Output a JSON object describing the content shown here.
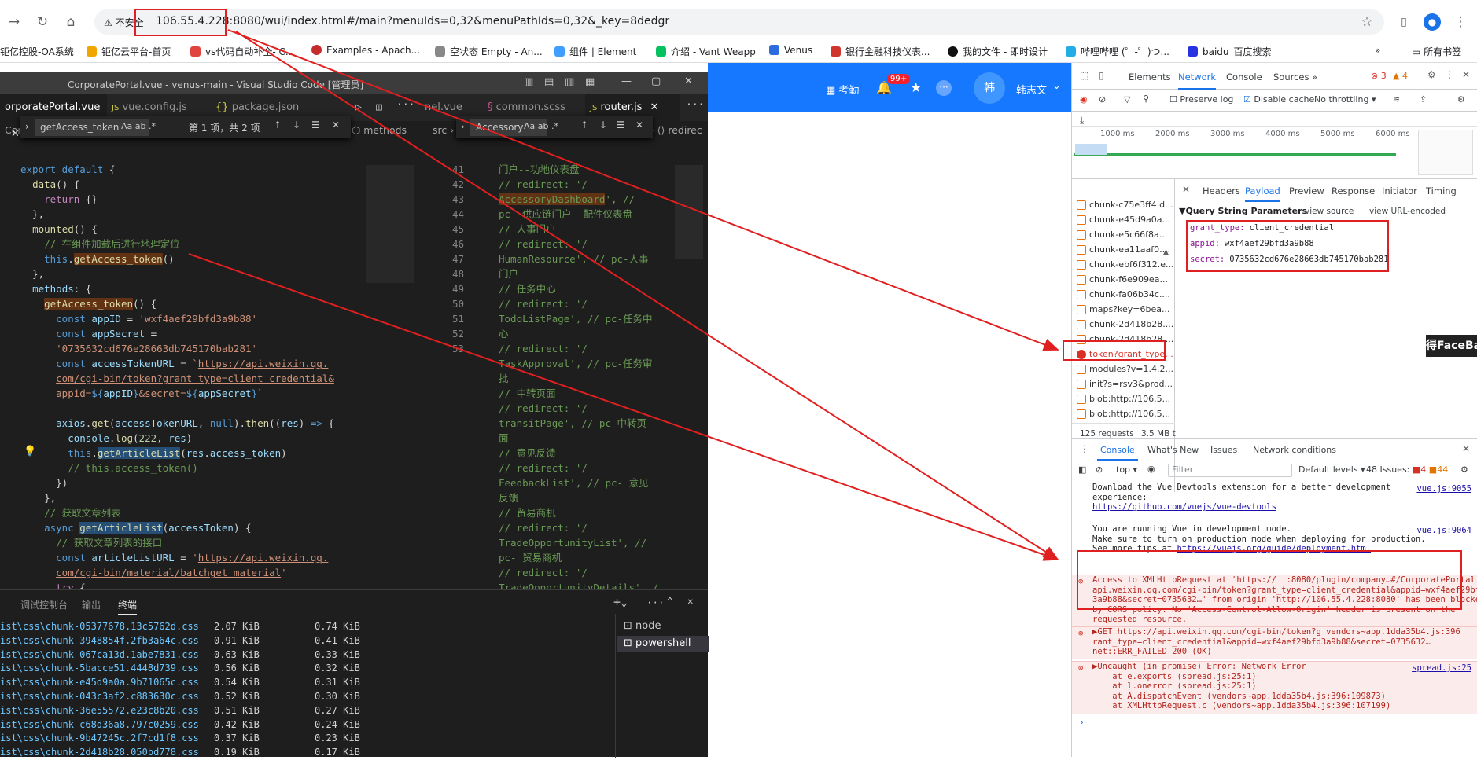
{
  "browser": {
    "security_label": "不安全",
    "url": "106.55.4.228:8080/wui/index.html#/main?menuIds=0,32&menuPathIds=0,32&_key=8dedgr",
    "bookmarks": [
      "钜亿控股-OA系统",
      "钜亿云平台-首页",
      "vs代码自动补全- C...",
      "Examples - Apach...",
      "空状态 Empty - An...",
      "组件 | Element",
      "介绍 - Vant Weapp",
      "Venus",
      "银行金融科技仪表...",
      "我的文件 - 即时设计",
      "哔哩哔哩 (゜-゜)つ...",
      "baidu_百度搜索"
    ],
    "all_bookmarks": "所有书签"
  },
  "app_header": {
    "attendance": "考勤",
    "badge": "99+",
    "user_initial": "韩",
    "user_name": "韩志文"
  },
  "vscode": {
    "title": "CorporatePortal.vue - venus-main - Visual Studio Code [管理员]",
    "tabs": [
      {
        "label": "orporatePortal.vue",
        "icon": "V",
        "icon_color": "#42b883",
        "active": true,
        "close": "✕"
      },
      {
        "label": "vue.config.js",
        "icon": "JS",
        "icon_color": "#cbcb41",
        "active": false
      },
      {
        "label": "package.json",
        "icon": "{}",
        "icon_color": "#cbcb41",
        "active": false
      }
    ],
    "right_tabs": [
      {
        "label": "nel.vue",
        "icon": "",
        "icon_color": "#42b883"
      },
      {
        "label": "common.scss",
        "icon": "§",
        "icon_color": "#c6538c"
      },
      {
        "label": "router.js",
        "icon": "JS",
        "icon_color": "#cbcb41",
        "close": "✕"
      }
    ],
    "left_breadcrumb": "CorporatePortal.vue › {} \"CorporatePortal.vue\" › ⟨⟩ script › ⬡ default › ⬡ methods",
    "right_breadcrumb": "src › router › JS router.js › ⟨⟩ constantRoutes › ⟨⟩ redirec",
    "find_left": {
      "query": "getAccess_token",
      "opts": "Aa  ab  .*",
      "result": "第 1 项，共 2 项"
    },
    "find_right": {
      "query": "Accessory",
      "opts": "Aa  ab  .*"
    },
    "right_line_numbers": [
      "",
      "41",
      "",
      "",
      "42",
      "43",
      "",
      "",
      "44",
      "45",
      "",
      "46",
      "",
      "47",
      "48",
      "",
      "49",
      "50",
      "",
      "51",
      "52",
      "",
      "53"
    ],
    "panel_tabs": [
      "调试控制台",
      "输出",
      "终端"
    ],
    "terminal_rows": [
      [
        "ist\\css\\chunk-05377678.13c5762d.css",
        "2.07 KiB",
        "0.74 KiB"
      ],
      [
        "ist\\css\\chunk-3948854f.2fb3a64c.css",
        "0.91 KiB",
        "0.41 KiB"
      ],
      [
        "ist\\css\\chunk-067ca13d.1abe7831.css",
        "0.63 KiB",
        "0.33 KiB"
      ],
      [
        "ist\\css\\chunk-5bacce51.4448d739.css",
        "0.56 KiB",
        "0.32 KiB"
      ],
      [
        "ist\\css\\chunk-e45d9a0a.9b71065c.css",
        "0.54 KiB",
        "0.31 KiB"
      ],
      [
        "ist\\css\\chunk-043c3af2.c883630c.css",
        "0.52 KiB",
        "0.30 KiB"
      ],
      [
        "ist\\css\\chunk-36e55572.e23c8b20.css",
        "0.51 KiB",
        "0.27 KiB"
      ],
      [
        "ist\\css\\chunk-c68d36a8.797c0259.css",
        "0.42 KiB",
        "0.24 KiB"
      ],
      [
        "ist\\css\\chunk-9b47245c.2f7cd1f8.css",
        "0.37 KiB",
        "0.23 KiB"
      ],
      [
        "ist\\css\\chunk-2d418b28.050bd778.css",
        "0.19 KiB",
        "0.17 KiB"
      ]
    ],
    "terminals": [
      "node",
      "powershell"
    ]
  },
  "devtools": {
    "tabs": [
      "Elements",
      "Network",
      "Console",
      "Sources"
    ],
    "active_tab": "Network",
    "counts": {
      "errors": "3",
      "warnings": "4"
    },
    "preserve_log": "Preserve log",
    "disable_cache": "Disable cache",
    "throttle": "No throttling",
    "timeline_ticks": [
      "1000 ms",
      "2000 ms",
      "3000 ms",
      "4000 ms",
      "5000 ms",
      "6000 ms"
    ],
    "requests": [
      {
        "name": "chunk-c75e3ff4.d...",
        "error": false
      },
      {
        "name": "chunk-e45d9a0a...",
        "error": false
      },
      {
        "name": "chunk-e5c66f8a...",
        "error": false
      },
      {
        "name": "chunk-ea11aaf0....",
        "error": false
      },
      {
        "name": "chunk-ebf6f312.e...",
        "error": false
      },
      {
        "name": "chunk-f6e909ea...",
        "error": false
      },
      {
        "name": "chunk-fa06b34c....",
        "error": false
      },
      {
        "name": "maps?key=6bea...",
        "error": false
      },
      {
        "name": "chunk-2d418b28....",
        "error": false
      },
      {
        "name": "chunk-2d418b28....",
        "error": false
      },
      {
        "name": "token?grant_type...",
        "error": true
      },
      {
        "name": "modules?v=1.4.2...",
        "error": false
      },
      {
        "name": "init?s=rsv3&prod...",
        "error": false
      },
      {
        "name": "blob:http://106.5...",
        "error": false
      },
      {
        "name": "blob:http://106.5...",
        "error": false
      }
    ],
    "request_count": "125 requests",
    "transfer": "3.5 MB t",
    "detail_tabs": [
      "Headers",
      "Payload",
      "Preview",
      "Response",
      "Initiator",
      "Timing"
    ],
    "active_detail": "Payload",
    "qsp_title": "▼Query String Parameters",
    "view_source": "view source",
    "view_url": "view URL-encoded",
    "params": [
      {
        "key": "grant_type:",
        "value": "client_credential"
      },
      {
        "key": "appid:",
        "value": "wxf4aef29bfd3a9b88"
      },
      {
        "key": "secret:",
        "value": "0735632cd676e28663db745170bab281"
      }
    ],
    "faceba": "得FaceBar",
    "console_tabs": [
      "Console",
      "What's New",
      "Issues",
      "Network conditions"
    ],
    "console_context": "top",
    "filter_placeholder": "Filter",
    "levels": "Default levels",
    "issues": "48 Issues:",
    "issue_err": "4",
    "issue_warn": "44",
    "messages": {
      "m1": "Download the Vue Devtools extension for a better development\nexperience:",
      "m1_link": "https://github.com/vuejs/vue-devtools",
      "m1_src": "vue.js:9055",
      "m2": "You are running Vue in development mode.\nMake sure to turn on production mode when deploying for production.\nSee more tips at",
      "m2_link": "https://vuejs.org/guide/deployment.html",
      "m2_src": "vue.js:9064",
      "m3": "Access to XMLHttpRequest at 'https://  :8080/plugin/company…#/CorporatePortal:1\napi.weixin.qq.com/cgi-bin/token?grant_type=client_credential&appid=wxf4aef29bfd\n3a9b88&secret=0735632…' from origin 'http://106.55.4.228:8080' has been blocked\nby CORS policy: No 'Access-Control-Allow-Origin' header is present on the\nrequested resource.",
      "m4": "▶GET https://api.weixin.qq.com/cgi-bin/token?g vendors~app.1dda35b4.js:396\nrant_type=client_credential&appid=wxf4aef29bfd3a9b88&secret=0735632…\nnet::ERR_FAILED 200 (OK)",
      "m5": "▶Uncaught (in promise) Error: Network Error\n    at e.exports (spread.js:25:1)\n    at l.onerror (spread.js:25:1)\n    at A.dispatchEvent (vendors~app.1dda35b4.js:396:109873)\n    at XMLHttpRequest.c (vendors~app.1dda35b4.js:396:107199)",
      "m5_src": "spread.js:25"
    }
  }
}
